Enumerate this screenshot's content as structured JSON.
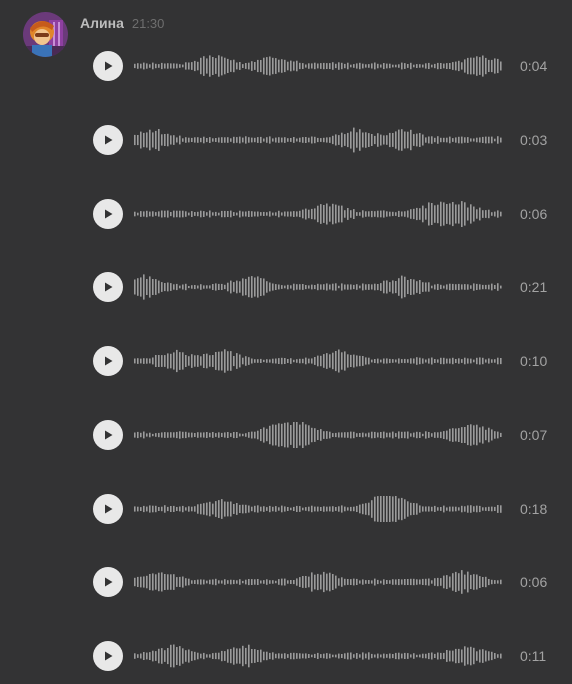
{
  "message": {
    "sender": "Алина",
    "time": "21:30"
  },
  "icons": {
    "avatar": "avatar-image",
    "play": "play-icon"
  },
  "colors": {
    "background": "#333334",
    "waveform": "#9b9b9b",
    "play_button": "#e8e8e8",
    "play_glyph": "#333334"
  },
  "voice_messages": [
    {
      "duration": "0:04"
    },
    {
      "duration": "0:03"
    },
    {
      "duration": "0:06"
    },
    {
      "duration": "0:21"
    },
    {
      "duration": "0:10"
    },
    {
      "duration": "0:07"
    },
    {
      "duration": "0:18"
    },
    {
      "duration": "0:06"
    },
    {
      "duration": "0:11"
    }
  ]
}
